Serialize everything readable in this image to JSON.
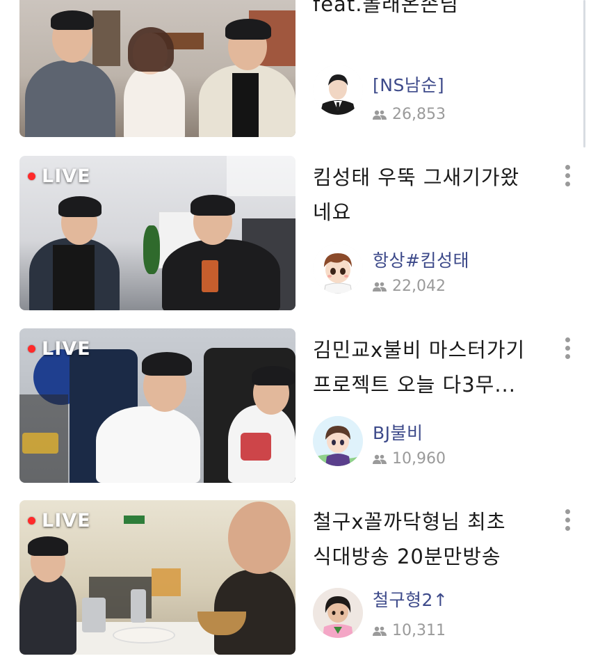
{
  "live_label": "LIVE",
  "cards": [
    {
      "title_lines": [
        "feat.몰래온손님"
      ],
      "live": false,
      "channel": "[NS남순]",
      "viewers": "26,853"
    },
    {
      "title_lines": [
        "킴성태 우뚝 그새기가왔",
        "네요"
      ],
      "live": true,
      "channel": "항상#킴성태",
      "viewers": "22,042"
    },
    {
      "title_lines": [
        "김민교x불비 마스터가기",
        "프로젝트 오늘 다3무..."
      ],
      "live": true,
      "channel": "BJ불비",
      "viewers": "10,960"
    },
    {
      "title_lines": [
        "철구x꼴까닥형님 최초",
        "식대방송 20분만방송"
      ],
      "live": true,
      "channel": "철구형2↑",
      "viewers": "10,311"
    }
  ],
  "icons": {
    "viewers": "people-icon",
    "menu": "more-vert-icon"
  },
  "colors": {
    "live_dot": "#ff2a2a",
    "channel_text": "#3d4a8a",
    "muted_text": "#9a9a9a"
  }
}
